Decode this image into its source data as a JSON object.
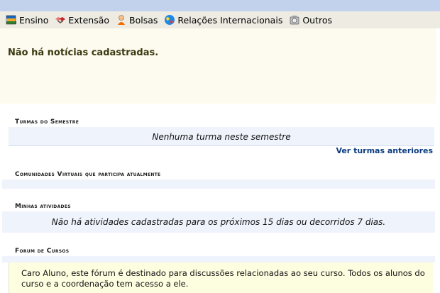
{
  "menu": {
    "items": [
      {
        "label": "Ensino"
      },
      {
        "label": "Extensão"
      },
      {
        "label": "Bolsas"
      },
      {
        "label": "Relações Internacionais"
      },
      {
        "label": "Outros"
      }
    ]
  },
  "news": {
    "message": "Não há notícias cadastradas."
  },
  "turmas": {
    "title": "Turmas do Semestre",
    "empty_message": "Nenhuma turma neste semestre",
    "link": "Ver turmas anteriores"
  },
  "comunidades": {
    "title": "Comunidades Virtuais que participa atualmente"
  },
  "atividades": {
    "title": "Minhas atividades",
    "empty_message": "Não há atividades cadastradas para os próximos 15 dias ou decorridos 7 dias."
  },
  "forum": {
    "title": "Forum de Cursos",
    "message": "Caro Aluno, este fórum é destinado para discussões relacionadas ao seu curso. Todos os alunos do curso e a coordenação tem acesso a ele."
  },
  "colors": {
    "topbar": "#c3d2ec",
    "menubar": "#eeebe3",
    "news_bg": "#fdfaef",
    "band_bg": "#eff3fb",
    "link": "#0a3b7f",
    "forum_bg": "#fdfde0"
  }
}
